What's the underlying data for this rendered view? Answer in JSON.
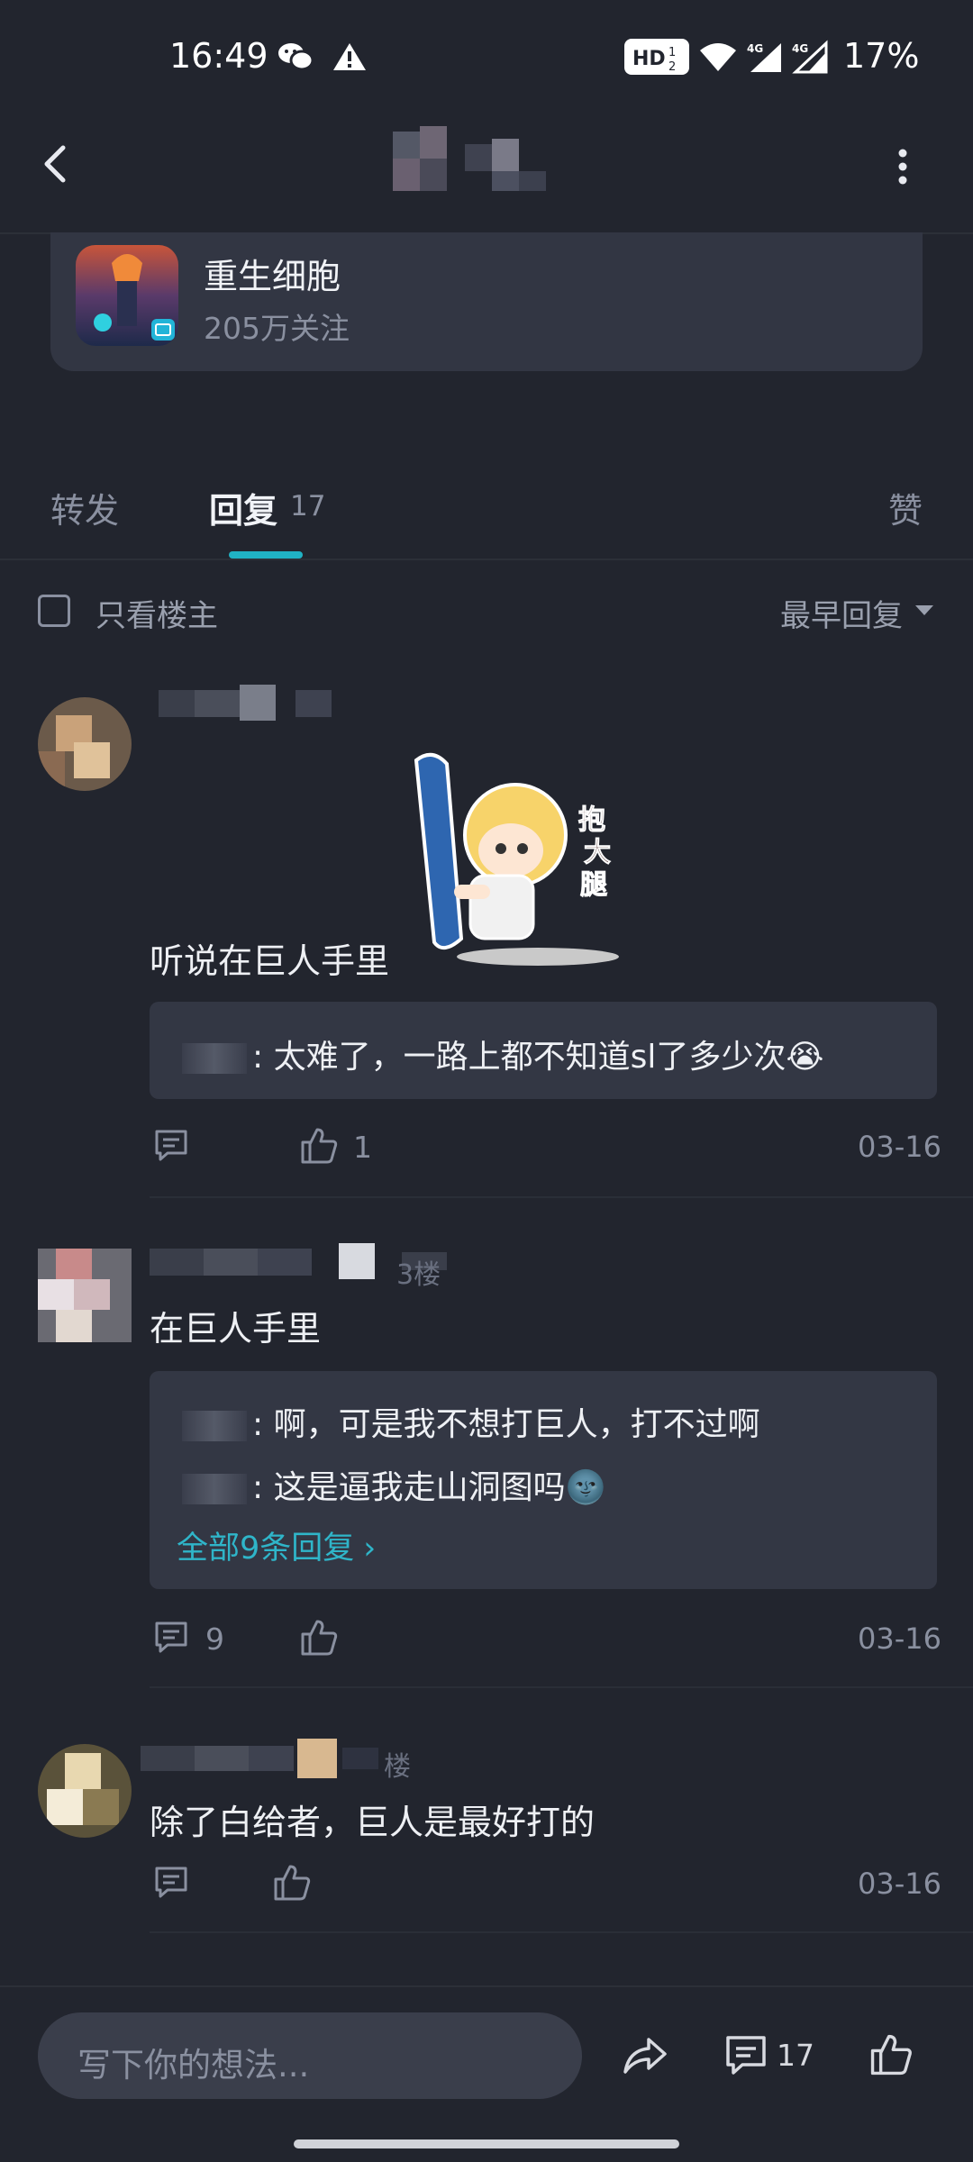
{
  "status_bar": {
    "time": "16:49",
    "battery": "17%",
    "icons": [
      "wechat-icon",
      "warning-icon",
      "hd-icon",
      "wifi-icon",
      "signal-4g-icon",
      "signal-4g-icon"
    ],
    "hd_label": "HD",
    "network_label": "4G"
  },
  "header": {
    "back_icon": "chevron-left-icon",
    "more_icon": "more-vertical-icon"
  },
  "game": {
    "name": "重生细胞",
    "followers": "205万关注"
  },
  "tabs": {
    "forward": "转发",
    "reply": "回复",
    "reply_count": "17",
    "like": "赞"
  },
  "filter": {
    "only_op": "只看楼主",
    "sort": "最早回复"
  },
  "comments": [
    {
      "text": "听说在巨人手里",
      "sticker_text": "抱大腿",
      "replies": [
        {
          "text": "太难了，一路上都不知道sl了多少次😭"
        }
      ],
      "likes": "1",
      "date": "03-16"
    },
    {
      "floor": "3楼",
      "text": "在巨人手里",
      "replies": [
        {
          "text": "啊，可是我不想打巨人，打不过啊"
        },
        {
          "text": "这是逼我走山洞图吗🌚"
        }
      ],
      "all_replies": "全部9条回复",
      "reply_count": "9",
      "date": "03-16"
    },
    {
      "floor": "楼",
      "text": "除了白给者，巨人是最好打的",
      "date": "03-16"
    }
  ],
  "bottom_bar": {
    "placeholder": "写下你的想法...",
    "comment_count": "17"
  }
}
